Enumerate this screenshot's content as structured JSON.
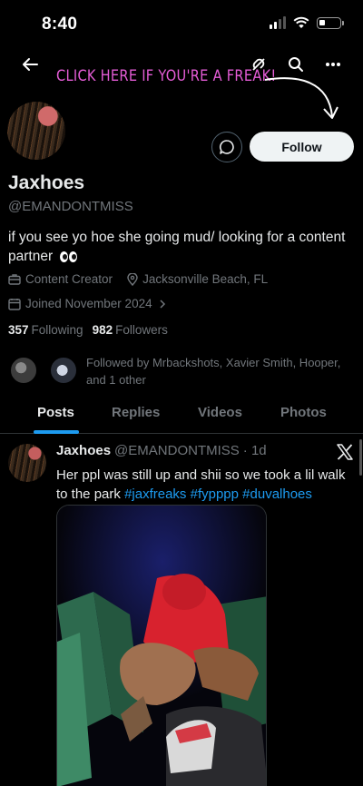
{
  "status_bar": {
    "time": "8:40"
  },
  "overlay": {
    "text": "CLICK HERE IF YOU'RE A FREAK!"
  },
  "profile": {
    "display_name": "Jaxhoes",
    "handle": "@EMANDONTMISS",
    "bio": "if you see yo hoe she going mud/ looking for a content partner",
    "category": "Content Creator",
    "location": "Jacksonville Beach, FL",
    "joined": "Joined November 2024",
    "following_count": "357",
    "following_label": "Following",
    "followers_count": "982",
    "followers_label": "Followers",
    "followed_by": "Followed by Mrbackshots, Xavier Smith, Hooper, and 1 other"
  },
  "actions": {
    "follow_label": "Follow"
  },
  "tabs": [
    {
      "label": "Posts",
      "active": true
    },
    {
      "label": "Replies",
      "active": false
    },
    {
      "label": "Videos",
      "active": false
    },
    {
      "label": "Photos",
      "active": false
    }
  ],
  "post": {
    "author": "Jaxhoes",
    "handle": "@EMANDONTMISS",
    "time": "· 1d",
    "text": "Her ppl was still up and shii so we took a lil walk to the park",
    "hashtags": [
      "#jaxfreaks",
      "#fypppp",
      "#duvalhoes"
    ]
  },
  "colors": {
    "accent": "#1d9bf0",
    "overlay_text": "#e45cd6",
    "follow_button_bg": "#eff3f4",
    "secondary_text": "#71767b"
  },
  "icons": [
    "back-arrow-icon",
    "unlink-icon",
    "search-icon",
    "more-icon",
    "message-icon",
    "briefcase-icon",
    "location-pin-icon",
    "calendar-icon",
    "chevron-right-icon",
    "x-logo-icon"
  ]
}
